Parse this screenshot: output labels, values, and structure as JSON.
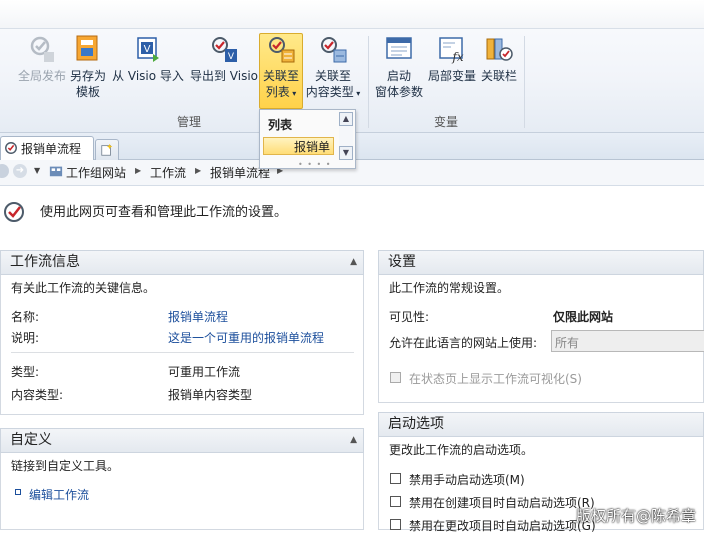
{
  "ribbon": {
    "buttons": {
      "global_publish": "全局发布",
      "save_as_template_1": "另存为",
      "save_as_template_2": "模板",
      "import_visio": "从 Visio 导入",
      "export_visio": "导出到 Visio",
      "assoc_list_1": "关联至",
      "assoc_list_2": "列表",
      "assoc_ct_1": "关联至",
      "assoc_ct_2": "内容类型",
      "startup_params_1": "启动",
      "startup_params_2": "窗体参数",
      "local_vars": "局部变量",
      "assoc_columns": "关联栏"
    },
    "groups": {
      "manage": "管理",
      "variables": "变量"
    }
  },
  "dropdown": {
    "header": "列表",
    "item": "报销单",
    "grip": "• • • •"
  },
  "tabs": {
    "active": "报销单流程"
  },
  "breadcrumb": [
    "工作组网站",
    "工作流",
    "报销单流程"
  ],
  "intro": "使用此网页可查看和管理此工作流的设置。",
  "workflow_info": {
    "title": "工作流信息",
    "desc": "有关此工作流的关键信息。",
    "name_label": "名称:",
    "name_value": "报销单流程",
    "desc_label": "说明:",
    "desc_value": "这是一个可重用的报销单流程",
    "type_label": "类型:",
    "type_value": "可重用工作流",
    "ct_label": "内容类型:",
    "ct_value": "报销单内容类型"
  },
  "customize": {
    "title": "自定义",
    "desc": "链接到自定义工具。",
    "link": "编辑工作流"
  },
  "settings": {
    "title": "设置",
    "desc": "此工作流的常规设置。",
    "visibility_label": "可见性:",
    "visibility_value": "仅限此网站",
    "language_label": "允许在此语言的网站上使用:",
    "language_value": "所有",
    "show_viz": "在状态页上显示工作流可视化(S)"
  },
  "startup": {
    "title": "启动选项",
    "desc": "更改此工作流的启动选项。",
    "opt1": "禁用手动启动选项(M)",
    "opt2": "禁用在创建项目时自动启动选项(R)",
    "opt3": "禁用在更改项目时自动启动选项(G)"
  },
  "watermark": "版权所有@陈希章"
}
